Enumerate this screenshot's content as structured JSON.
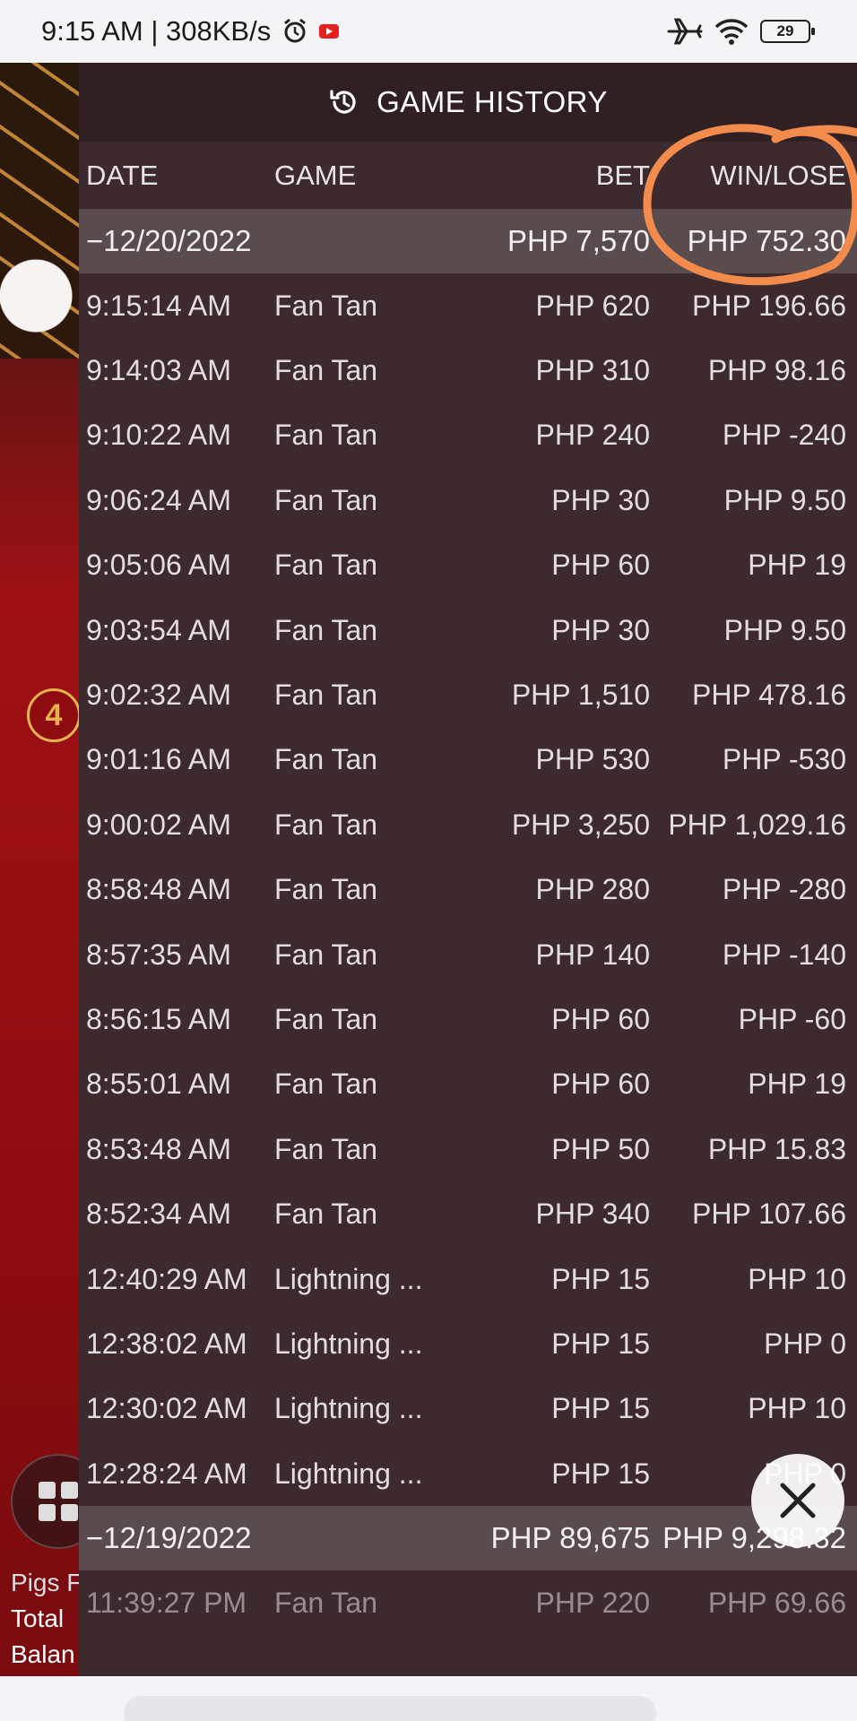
{
  "status_bar": {
    "time_speed": "9:15 AM | 308KB/s",
    "battery": "29"
  },
  "background": {
    "round_badge": "4",
    "labels": [
      "Pigs F",
      "Total",
      "Balan"
    ]
  },
  "history": {
    "title": "GAME HISTORY",
    "columns": {
      "date": "DATE",
      "game": "GAME",
      "bet": "BET",
      "win": "WIN/LOSE"
    },
    "days": [
      {
        "date": "−12/20/2022",
        "bet": "PHP 7,570",
        "win": "PHP 752.30",
        "rows": [
          {
            "time": "9:15:14 AM",
            "game": "Fan Tan",
            "bet": "PHP 620",
            "win": "PHP 196.66"
          },
          {
            "time": "9:14:03 AM",
            "game": "Fan Tan",
            "bet": "PHP 310",
            "win": "PHP 98.16"
          },
          {
            "time": "9:10:22 AM",
            "game": "Fan Tan",
            "bet": "PHP 240",
            "win": "PHP -240"
          },
          {
            "time": "9:06:24 AM",
            "game": "Fan Tan",
            "bet": "PHP 30",
            "win": "PHP 9.50"
          },
          {
            "time": "9:05:06 AM",
            "game": "Fan Tan",
            "bet": "PHP 60",
            "win": "PHP 19"
          },
          {
            "time": "9:03:54 AM",
            "game": "Fan Tan",
            "bet": "PHP 30",
            "win": "PHP 9.50"
          },
          {
            "time": "9:02:32 AM",
            "game": "Fan Tan",
            "bet": "PHP 1,510",
            "win": "PHP 478.16"
          },
          {
            "time": "9:01:16 AM",
            "game": "Fan Tan",
            "bet": "PHP 530",
            "win": "PHP -530"
          },
          {
            "time": "9:00:02 AM",
            "game": "Fan Tan",
            "bet": "PHP 3,250",
            "win": "PHP 1,029.16"
          },
          {
            "time": "8:58:48 AM",
            "game": "Fan Tan",
            "bet": "PHP 280",
            "win": "PHP -280"
          },
          {
            "time": "8:57:35 AM",
            "game": "Fan Tan",
            "bet": "PHP 140",
            "win": "PHP -140"
          },
          {
            "time": "8:56:15 AM",
            "game": "Fan Tan",
            "bet": "PHP 60",
            "win": "PHP -60"
          },
          {
            "time": "8:55:01 AM",
            "game": "Fan Tan",
            "bet": "PHP 60",
            "win": "PHP 19"
          },
          {
            "time": "8:53:48 AM",
            "game": "Fan Tan",
            "bet": "PHP 50",
            "win": "PHP 15.83"
          },
          {
            "time": "8:52:34 AM",
            "game": "Fan Tan",
            "bet": "PHP 340",
            "win": "PHP 107.66"
          },
          {
            "time": "12:40:29 AM",
            "game": "Lightning ...",
            "bet": "PHP 15",
            "win": "PHP 10"
          },
          {
            "time": "12:38:02 AM",
            "game": "Lightning ...",
            "bet": "PHP 15",
            "win": "PHP 0"
          },
          {
            "time": "12:30:02 AM",
            "game": "Lightning ...",
            "bet": "PHP 15",
            "win": "PHP 10"
          },
          {
            "time": "12:28:24 AM",
            "game": "Lightning ...",
            "bet": "PHP 15",
            "win": "PHP 0"
          }
        ]
      },
      {
        "date": "−12/19/2022",
        "bet": "PHP 89,675",
        "win": "PHP 9,298.32",
        "rows": [
          {
            "time": "11:39:27 PM",
            "game": "Fan Tan",
            "bet": "PHP 220",
            "win": "PHP 69.66"
          }
        ]
      }
    ]
  },
  "colors": {
    "overlay": "#3d2a2f",
    "header": "#302024",
    "day_row": "#5a4b4f",
    "annotation": "#f28b4b",
    "game_red": "#8e0c10"
  }
}
